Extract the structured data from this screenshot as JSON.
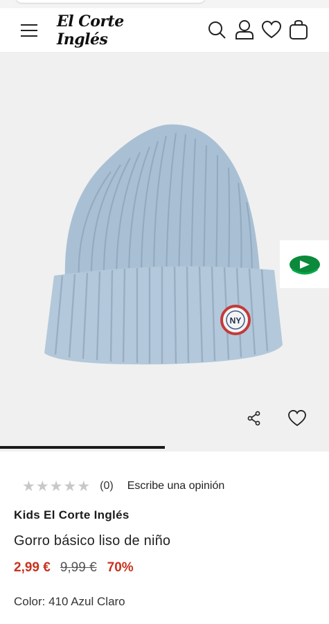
{
  "header": {
    "logo_text": "El Corte Inglés",
    "icons": [
      "menu-icon",
      "search-icon",
      "user-icon",
      "heart-icon",
      "shopping-bag-icon"
    ]
  },
  "gallery": {
    "image_alt": "Gorro básico liso de niño",
    "hat_color": "#aec3d6",
    "patch_text": "NY",
    "progress": 0.5,
    "ad_accent": "#0a8a3a"
  },
  "rating": {
    "stars_filled": 0,
    "stars_total": 5,
    "count_text": "(0)",
    "write_review": "Escribe una opinión"
  },
  "product": {
    "brand": "Kids El Corte Inglés",
    "title": "Gorro básico liso de niño",
    "price_now": "2,99 €",
    "price_old": "9,99 €",
    "discount": "70%",
    "color_text": "Color: 410 Azul Claro"
  },
  "colors": {
    "sale_red": "#c8321e",
    "background_gallery": "#f0f0f0"
  }
}
